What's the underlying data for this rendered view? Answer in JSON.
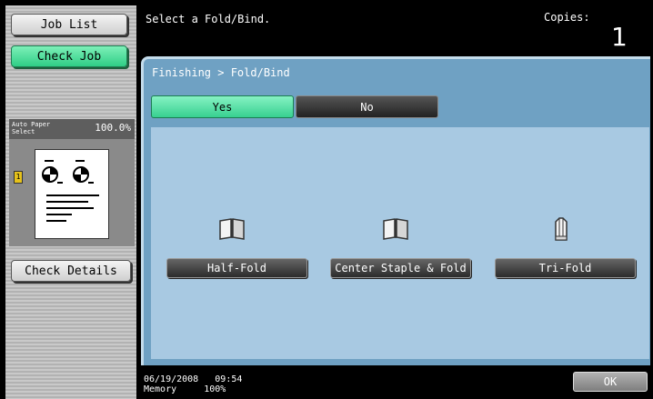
{
  "sidebar": {
    "job_list": "Job List",
    "check_job": "Check Job",
    "preview": {
      "line1": "Auto Paper",
      "line2": "Select",
      "zoom": "100.0%",
      "tray": "1"
    },
    "check_details": "Check Details"
  },
  "header": {
    "message": "Select a Fold/Bind.",
    "copies_label": "Copies:",
    "copies_value": "1"
  },
  "panel": {
    "breadcrumb": "Finishing > Fold/Bind",
    "yes": "Yes",
    "no": "No",
    "options": [
      {
        "label": "Half-Fold",
        "icon": "half-fold-icon"
      },
      {
        "label": "Center Staple & Fold",
        "icon": "center-staple-fold-icon"
      },
      {
        "label": "Tri-Fold",
        "icon": "tri-fold-icon"
      }
    ]
  },
  "footer": {
    "date": "06/19/2008",
    "time": "09:54",
    "memory_label": "Memory",
    "memory_value": "100%",
    "ok": "OK"
  },
  "colors": {
    "accent_green": "#37d090",
    "panel_blue": "#6fa1c3",
    "content_blue": "#a8c9e2"
  }
}
